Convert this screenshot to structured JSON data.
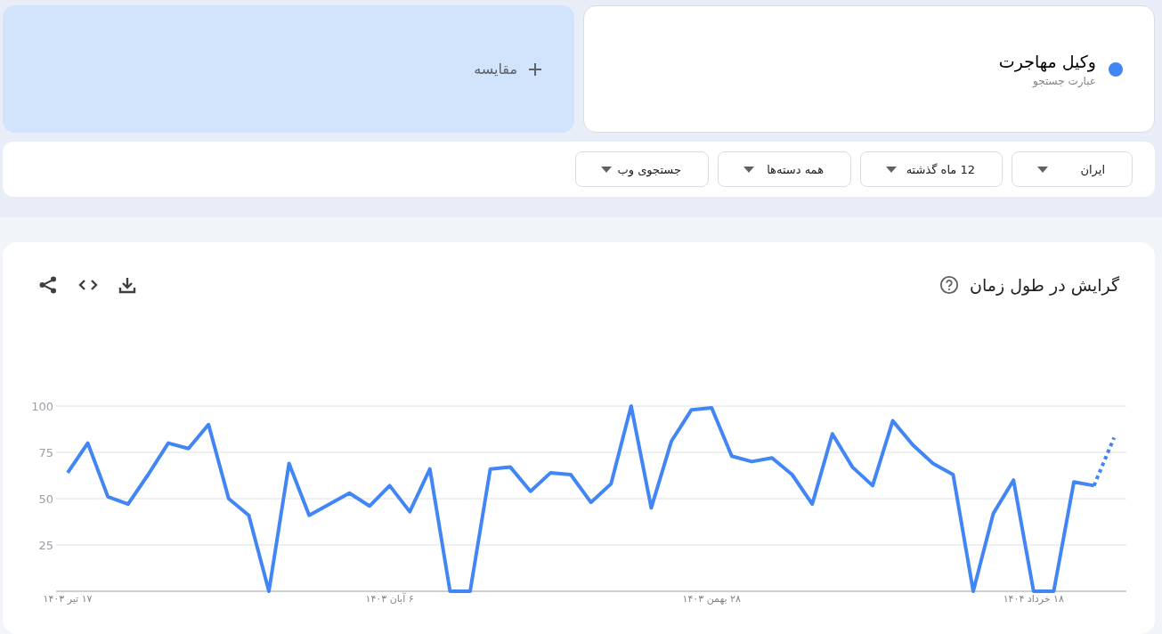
{
  "term": {
    "name": "وکیل مهاجرت",
    "subtitle": "عبارت جستجو",
    "color": "#4285f4"
  },
  "compare": {
    "label": "مقایسه"
  },
  "filters": [
    {
      "label": "ایران"
    },
    {
      "label": "12 ماه گذشته"
    },
    {
      "label": "همه دسته‌ها"
    },
    {
      "label": "جستجوی وب"
    }
  ],
  "trend": {
    "title": "گرایش در طول زمان",
    "chart_data": {
      "type": "line",
      "categories": [
        "۱۷ تیر ۱۴۰۳",
        null,
        null,
        null,
        null,
        null,
        null,
        null,
        null,
        null,
        null,
        null,
        null,
        null,
        null,
        null,
        "۶ آبان ۱۴۰۳",
        null,
        null,
        null,
        null,
        null,
        null,
        null,
        null,
        null,
        null,
        null,
        null,
        null,
        null,
        null,
        "۲۸ بهمن ۱۴۰۳",
        null,
        null,
        null,
        null,
        null,
        null,
        null,
        null,
        null,
        null,
        null,
        null,
        null,
        null,
        null,
        "۱۸ خرداد ۱۴۰۴",
        null,
        null,
        null,
        null
      ],
      "series": [
        {
          "color": "#4285f4",
          "line_style": "solid",
          "values": [
            64,
            80,
            51,
            47,
            63,
            80,
            77,
            90,
            50,
            41,
            0,
            69,
            41,
            47,
            53,
            46,
            57,
            43,
            66,
            0,
            0,
            66,
            67,
            54,
            64,
            63,
            48,
            58,
            100,
            45,
            81,
            98,
            99,
            73,
            70,
            72,
            63,
            47,
            85,
            67,
            57,
            92,
            79,
            69,
            63,
            0,
            42,
            60,
            0,
            0,
            59,
            57,
            null
          ]
        },
        {
          "color": "#4285f4",
          "line_style": "dotted",
          "values": [
            null,
            null,
            null,
            null,
            null,
            null,
            null,
            null,
            null,
            null,
            null,
            null,
            null,
            null,
            null,
            null,
            null,
            null,
            null,
            null,
            null,
            null,
            null,
            null,
            null,
            null,
            null,
            null,
            null,
            null,
            null,
            null,
            null,
            null,
            null,
            null,
            null,
            null,
            null,
            null,
            null,
            null,
            null,
            null,
            null,
            null,
            null,
            null,
            null,
            null,
            null,
            57,
            83
          ]
        }
      ],
      "grid": true,
      "ylim": [
        0,
        100
      ],
      "yticks": [
        25,
        50,
        75,
        100
      ]
    }
  }
}
